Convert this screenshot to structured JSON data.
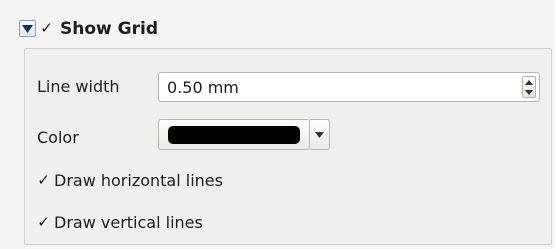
{
  "group": {
    "title": "Show Grid",
    "collapse_icon": "triangle-down-icon",
    "enabled": true
  },
  "line_width": {
    "label": "Line width",
    "value": "0.50 mm"
  },
  "color": {
    "label": "Color",
    "value": "#000000"
  },
  "draw_horizontal": {
    "label": "Draw horizontal lines",
    "checked": true
  },
  "draw_vertical": {
    "label": "Draw vertical lines",
    "checked": true
  },
  "check_glyph": "✓"
}
